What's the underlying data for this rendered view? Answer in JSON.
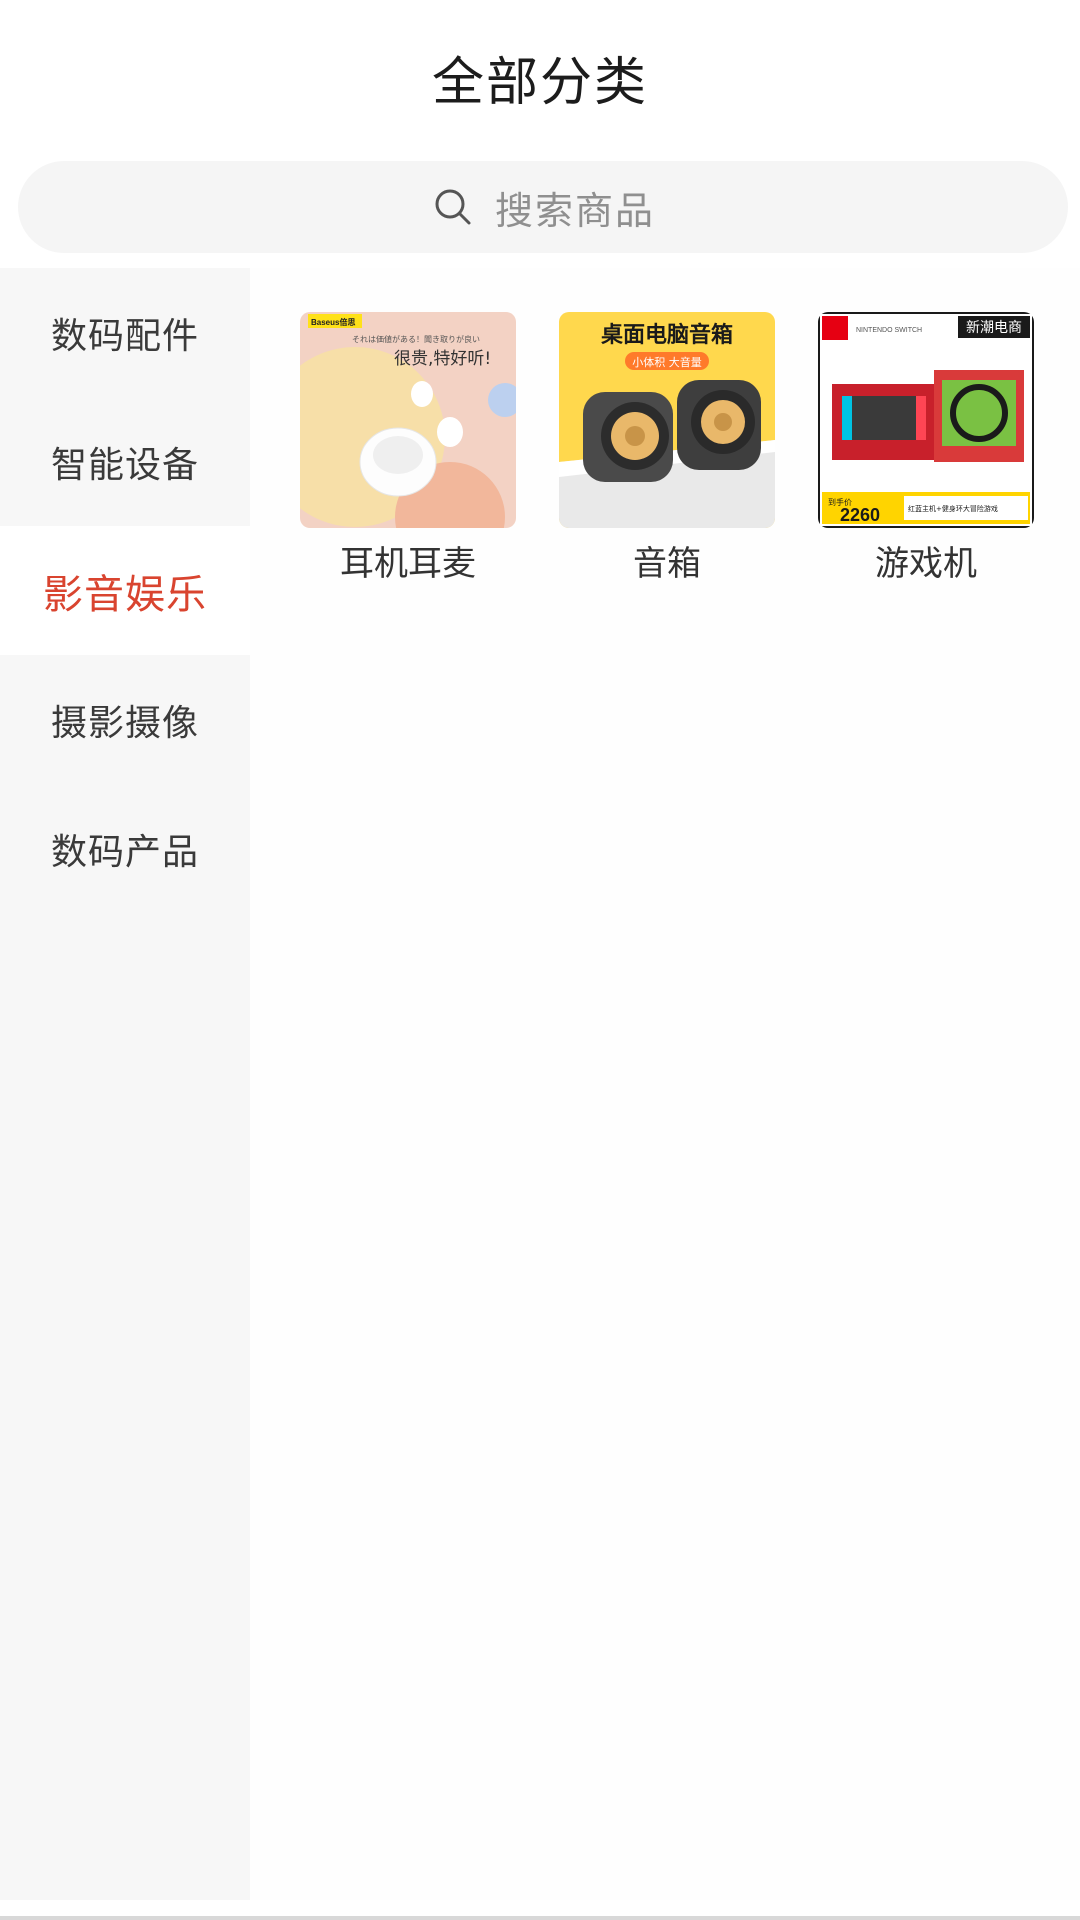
{
  "header": {
    "title": "全部分类"
  },
  "search": {
    "placeholder": "搜索商品"
  },
  "sidebar": {
    "active_index": 2,
    "items": [
      {
        "label": "数码配件"
      },
      {
        "label": "智能设备"
      },
      {
        "label": "影音娱乐"
      },
      {
        "label": "摄影摄像"
      },
      {
        "label": "数码产品"
      }
    ]
  },
  "content": {
    "categories": [
      {
        "label": "耳机耳麦",
        "image_text": {
          "brand": "Baseus倍思",
          "tagline": "それは価値がある！聞き取りが良い",
          "slogan": "很贵,特好听!"
        }
      },
      {
        "label": "音箱",
        "image_text": {
          "headline": "桌面电脑音箱",
          "badge": "小体积 大音量"
        }
      },
      {
        "label": "游戏机",
        "image_text": {
          "corner": "新潮电商",
          "caption": "NINTENDO SWITCH",
          "price_label": "到手价",
          "price": "2260",
          "promo": "红蓝主机+健身环大冒险游戏"
        }
      }
    ]
  },
  "colors": {
    "accent": "#d9442f",
    "sidebar_bg": "#f7f7f7",
    "search_bg": "#f5f5f5"
  }
}
